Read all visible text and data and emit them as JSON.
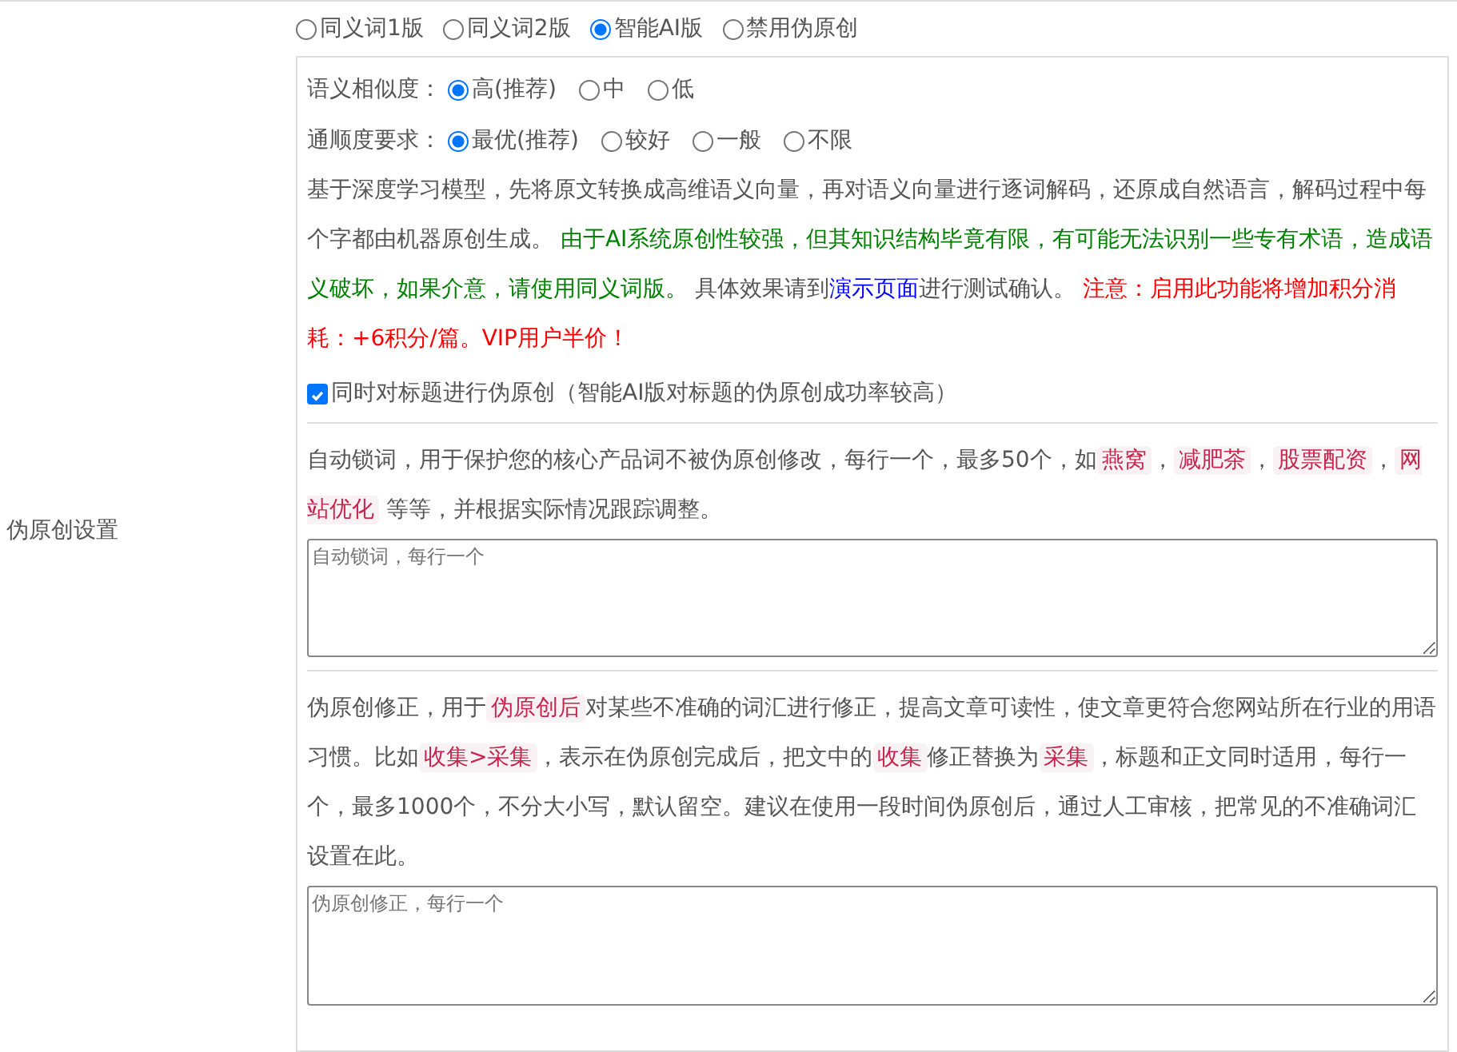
{
  "mode_options": [
    {
      "label": "同义词1版",
      "selected": false
    },
    {
      "label": "同义词2版",
      "selected": false
    },
    {
      "label": "智能AI版",
      "selected": true
    },
    {
      "label": "禁用伪原创",
      "selected": false
    }
  ],
  "section_label": "伪原创设置",
  "similarity": {
    "label": "语义相似度：",
    "options": [
      {
        "label": "高(推荐)",
        "selected": true
      },
      {
        "label": "中",
        "selected": false
      },
      {
        "label": "低",
        "selected": false
      }
    ]
  },
  "fluency": {
    "label": "通顺度要求：",
    "options": [
      {
        "label": "最优(推荐)",
        "selected": true
      },
      {
        "label": "较好",
        "selected": false
      },
      {
        "label": "一般",
        "selected": false
      },
      {
        "label": "不限",
        "selected": false
      }
    ]
  },
  "description": [
    {
      "kind": "plain",
      "text": "基于深度学习模型，先将原文转换成高维语义向量，再对语义向量进行逐词解码，还原成自然语言，解码过程中每个字都由机器原创生成。 "
    },
    {
      "kind": "green",
      "text": "由于AI系统原创性较强，但其知识结构毕竟有限，有可能无法识别一些专有术语，造成语义破坏，如果介意，请使用同义词版。"
    },
    {
      "kind": "plain",
      "text": " 具体效果请到"
    },
    {
      "kind": "link",
      "text": "演示页面"
    },
    {
      "kind": "plain",
      "text": "进行测试确认。 "
    },
    {
      "kind": "red",
      "text": "注意：启用此功能将增加积分消耗：+6积分/篇。VIP用户半价！"
    }
  ],
  "title_checkbox": {
    "label": "同时对标题进行伪原创（智能AI版对标题的伪原创成功率较高）",
    "checked": true
  },
  "lock_words": {
    "description": [
      {
        "kind": "plain",
        "text": "自动锁词，用于保护您的核心产品词不被伪原创修改，每行一个，最多50个，如"
      },
      {
        "kind": "code",
        "text": "燕窝"
      },
      {
        "kind": "plain",
        "text": "，"
      },
      {
        "kind": "code",
        "text": "减肥茶"
      },
      {
        "kind": "plain",
        "text": "，"
      },
      {
        "kind": "code",
        "text": "股票配资"
      },
      {
        "kind": "plain",
        "text": "，"
      },
      {
        "kind": "code",
        "text": "网站优化"
      },
      {
        "kind": "plain",
        "text": " 等等，并根据实际情况跟踪调整。"
      }
    ],
    "placeholder": "自动锁词，每行一个"
  },
  "correction": {
    "description": [
      {
        "kind": "plain",
        "text": "伪原创修正，用于"
      },
      {
        "kind": "code",
        "text": "伪原创后"
      },
      {
        "kind": "plain",
        "text": "对某些不准确的词汇进行修正，提高文章可读性，使文章更符合您网站所在行业的用语习惯。比如"
      },
      {
        "kind": "code",
        "text": "收集>采集"
      },
      {
        "kind": "plain",
        "text": "，表示在伪原创完成后，把文中的"
      },
      {
        "kind": "code",
        "text": "收集"
      },
      {
        "kind": "plain",
        "text": "修正替换为"
      },
      {
        "kind": "code",
        "text": "采集"
      },
      {
        "kind": "plain",
        "text": "，标题和正文同时适用，每行一个，最多1000个，不分大小写，默认留空。建议在使用一段时间伪原创后，通过人工审核，把常见的不准确词汇设置在此。"
      }
    ],
    "placeholder": "伪原创修正，每行一个"
  }
}
